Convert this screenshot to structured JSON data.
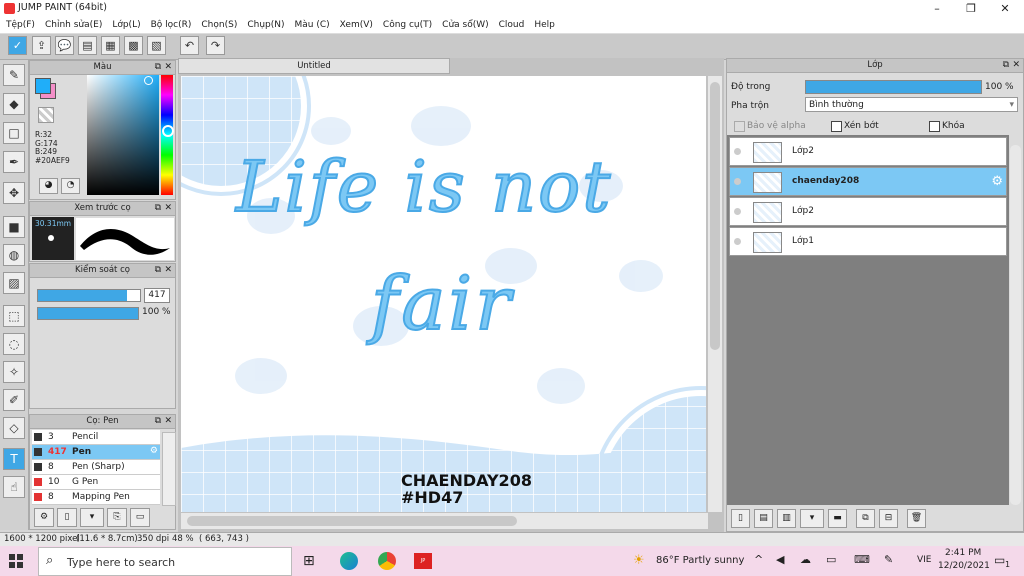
{
  "window": {
    "title": "JUMP PAINT (64bit)"
  },
  "menu": [
    "Tệp(F)",
    "Chỉnh sửa(E)",
    "Lớp(L)",
    "Bộ lọc(R)",
    "Chọn(S)",
    "Chụp(N)",
    "Màu (C)",
    "Xem(V)",
    "Công cụ(T)",
    "Cửa sổ(W)",
    "Cloud",
    "Help"
  ],
  "panels": {
    "color": {
      "title": "Màu",
      "r": "R:32",
      "g": "G:174",
      "b": "B:249",
      "hex": "#20AEF9",
      "fg": "#20AEF9",
      "bg": "#F48FC8"
    },
    "brush_preview": {
      "title": "Xem trước cọ",
      "size": "30.31mm"
    },
    "brush_control": {
      "title": "Kiểm soát cọ",
      "size_value": "417",
      "opacity_value": "100 %",
      "size_fill": 0.87,
      "opacity_fill": 1.0
    },
    "brush_list": {
      "title": "Cọ: Pen",
      "items": [
        {
          "size": "3",
          "name": "Pencil",
          "selected": false,
          "color": "#333333"
        },
        {
          "size": "417",
          "name": "Pen",
          "selected": true,
          "color": "#333333"
        },
        {
          "size": "8",
          "name": "Pen (Sharp)",
          "selected": false,
          "color": "#333333"
        },
        {
          "size": "10",
          "name": "G Pen",
          "selected": false,
          "color": "#e33333"
        },
        {
          "size": "8",
          "name": "Mapping Pen",
          "selected": false,
          "color": "#e33333"
        }
      ]
    }
  },
  "canvas": {
    "tab_label": "Untitled",
    "art_line1": "Life is not",
    "art_line2": "fair",
    "signature1": "CHAENDAY208",
    "signature2": "#HD47"
  },
  "layers": {
    "title": "Lớp",
    "opacity_label": "Độ trong",
    "opacity_value": "100 %",
    "blend_label": "Pha trộn",
    "blend_value": "Bình thường",
    "protect_alpha": "Bảo vệ alpha",
    "clipping": "Xén bớt",
    "lock": "Khóa",
    "items": [
      {
        "name": "Lớp2",
        "selected": false
      },
      {
        "name": "chaenday208",
        "selected": true
      },
      {
        "name": "Lớp2",
        "selected": false
      },
      {
        "name": "Lớp1",
        "selected": false
      }
    ]
  },
  "status": {
    "size": "1600 * 1200 pixel",
    "physical": "(11.6 * 8.7cm)",
    "dpi": "350 dpi",
    "zoom": "48 %",
    "coords": "( 663, 743 )"
  },
  "taskbar": {
    "search_placeholder": "Type here to search",
    "weather": "86°F  Partly sunny",
    "lang": "VIE",
    "time": "2:41 PM",
    "date": "12/20/2021",
    "notif_count": "1"
  }
}
